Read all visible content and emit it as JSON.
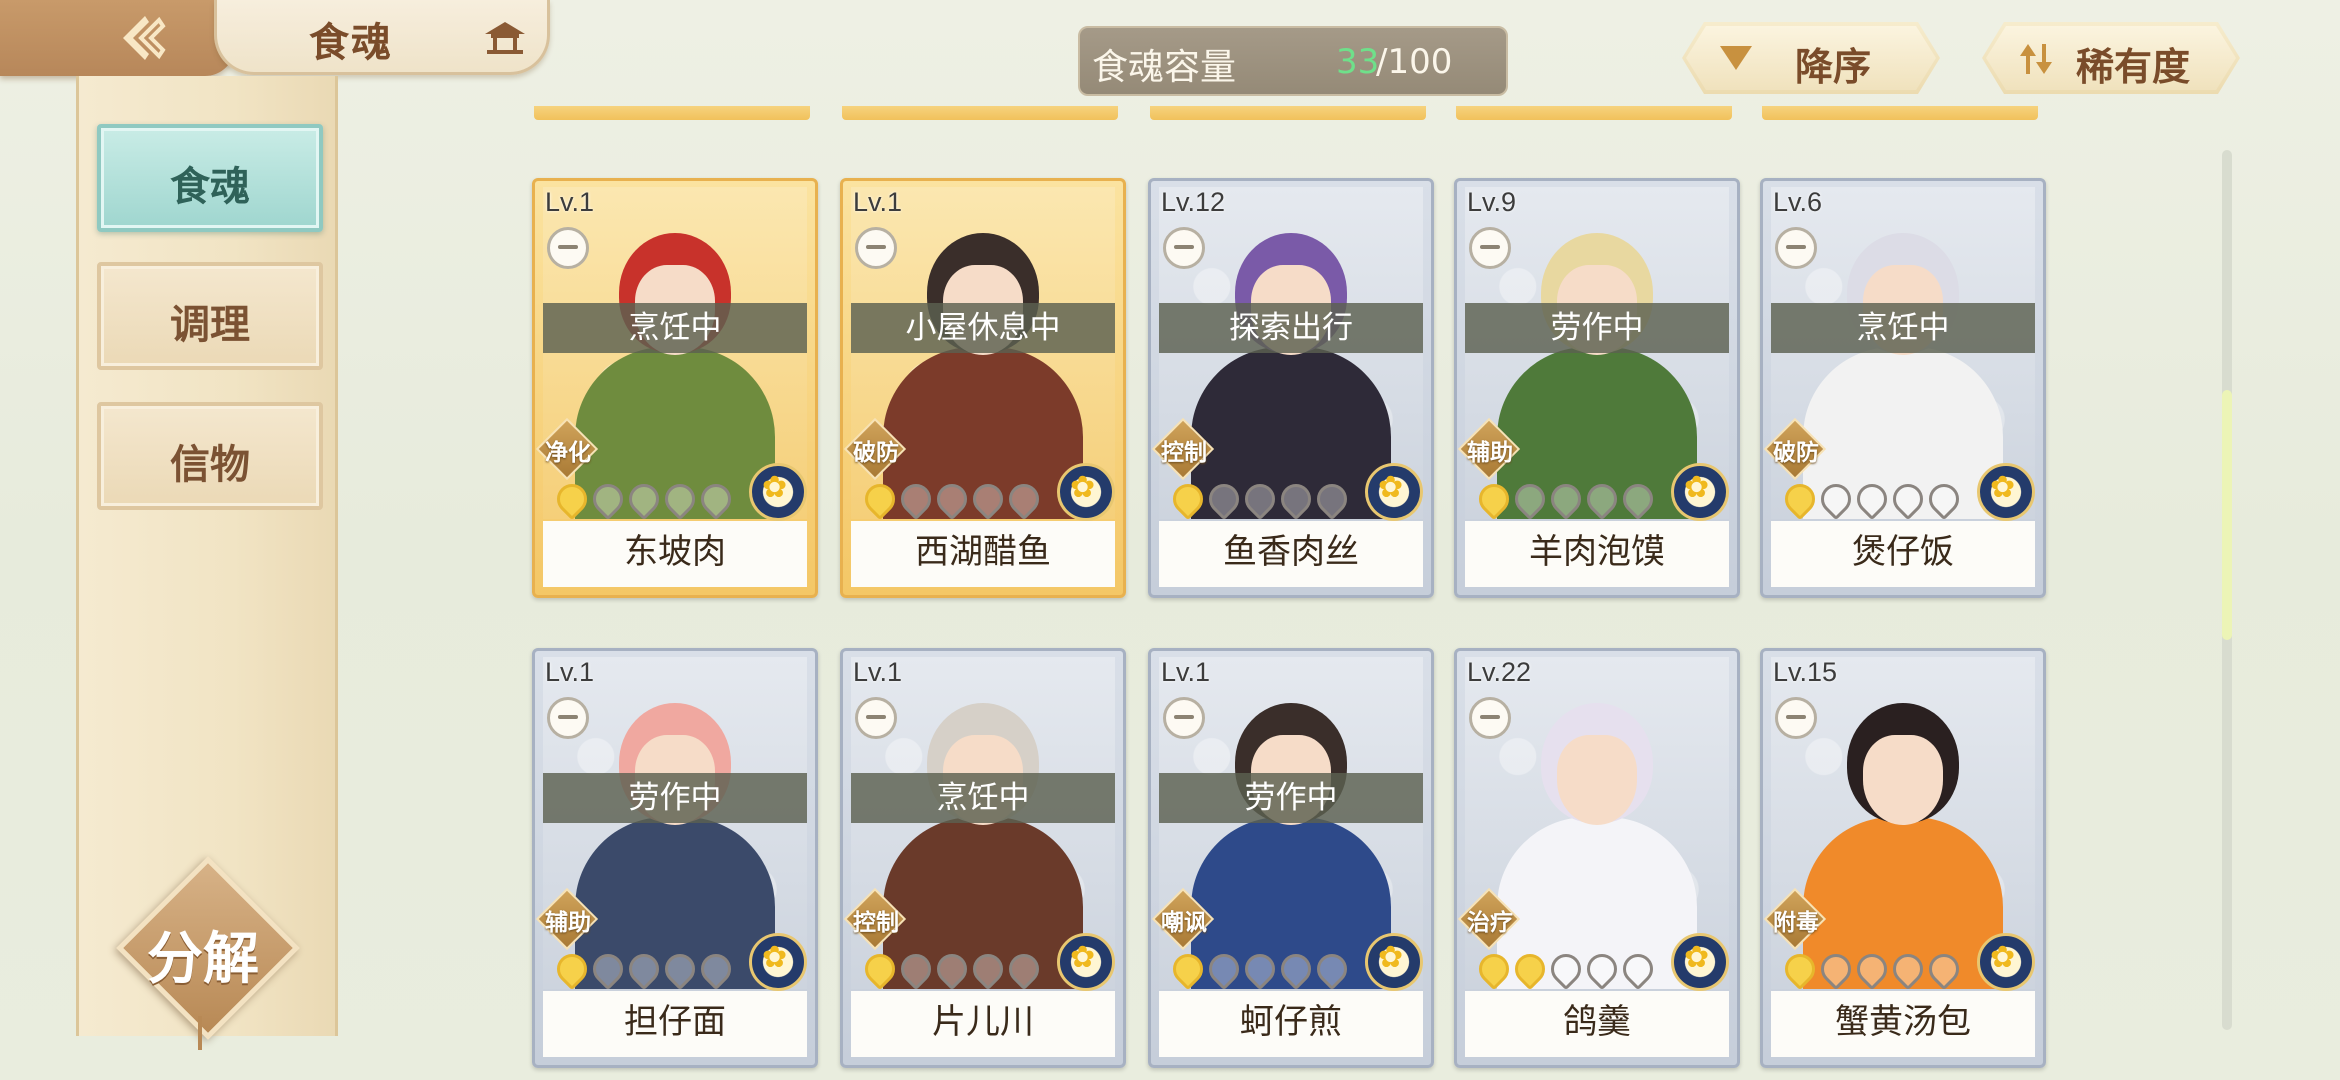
{
  "header": {
    "title": "食魂",
    "back_icon": "back-arrow-icon",
    "title_icon": "pavilion-icon",
    "capacity_label": "食魂容量",
    "capacity_current": "33",
    "capacity_max": "/100",
    "sort_order_label": "降序",
    "sort_key_label": "稀有度"
  },
  "sidebar": {
    "tabs": [
      {
        "label": "食魂",
        "active": true
      },
      {
        "label": "调理",
        "active": false
      },
      {
        "label": "信物",
        "active": false
      }
    ],
    "decompose_label": "分解"
  },
  "colors": {
    "accent_teal": "#9fd6cf",
    "gold_frame": "#e8b14f",
    "silver_frame": "#a7b1c2",
    "capacity_green": "#6fe08a"
  },
  "cards": [
    {
      "level": "Lv.1",
      "status": "烹饪中",
      "role": "净化",
      "name": "东坡肉",
      "stars": 1,
      "frame": "gold",
      "hair": "#c8322b",
      "outfit": "#6f8c3e"
    },
    {
      "level": "Lv.1",
      "status": "小屋休息中",
      "role": "破防",
      "name": "西湖醋鱼",
      "stars": 1,
      "frame": "gold",
      "hair": "#3a2e2a",
      "outfit": "#7c3b2a"
    },
    {
      "level": "Lv.12",
      "status": "探索出行",
      "role": "控制",
      "name": "鱼香肉丝",
      "stars": 1,
      "frame": "silver",
      "hair": "#7a5aa8",
      "outfit": "#2e2a38"
    },
    {
      "level": "Lv.9",
      "status": "劳作中",
      "role": "辅助",
      "name": "羊肉泡馍",
      "stars": 1,
      "frame": "silver",
      "hair": "#e8d8a0",
      "outfit": "#4f7a3a"
    },
    {
      "level": "Lv.6",
      "status": "烹饪中",
      "role": "破防",
      "name": "煲仔饭",
      "stars": 1,
      "frame": "silver",
      "hair": "#dcdce6",
      "outfit": "#f2f2f2"
    },
    {
      "level": "Lv.1",
      "status": "劳作中",
      "role": "辅助",
      "name": "担仔面",
      "stars": 1,
      "frame": "silver",
      "hair": "#f0a8a0",
      "outfit": "#3b4a6a"
    },
    {
      "level": "Lv.1",
      "status": "烹饪中",
      "role": "控制",
      "name": "片儿川",
      "stars": 1,
      "frame": "silver",
      "hair": "#d6d0c8",
      "outfit": "#6a3a2a"
    },
    {
      "level": "Lv.1",
      "status": "劳作中",
      "role": "嘲讽",
      "name": "蚵仔煎",
      "stars": 1,
      "frame": "silver",
      "hair": "#3a2e2a",
      "outfit": "#2e4a8a"
    },
    {
      "level": "Lv.22",
      "status": "",
      "role": "治疗",
      "name": "鸽羹",
      "stars": 2,
      "frame": "silver",
      "hair": "#e6e0ee",
      "outfit": "#f4f4f8"
    },
    {
      "level": "Lv.15",
      "status": "",
      "role": "附毒",
      "name": "蟹黄汤包",
      "stars": 1,
      "frame": "silver",
      "hair": "#2a2020",
      "outfit": "#f08a2a"
    }
  ]
}
